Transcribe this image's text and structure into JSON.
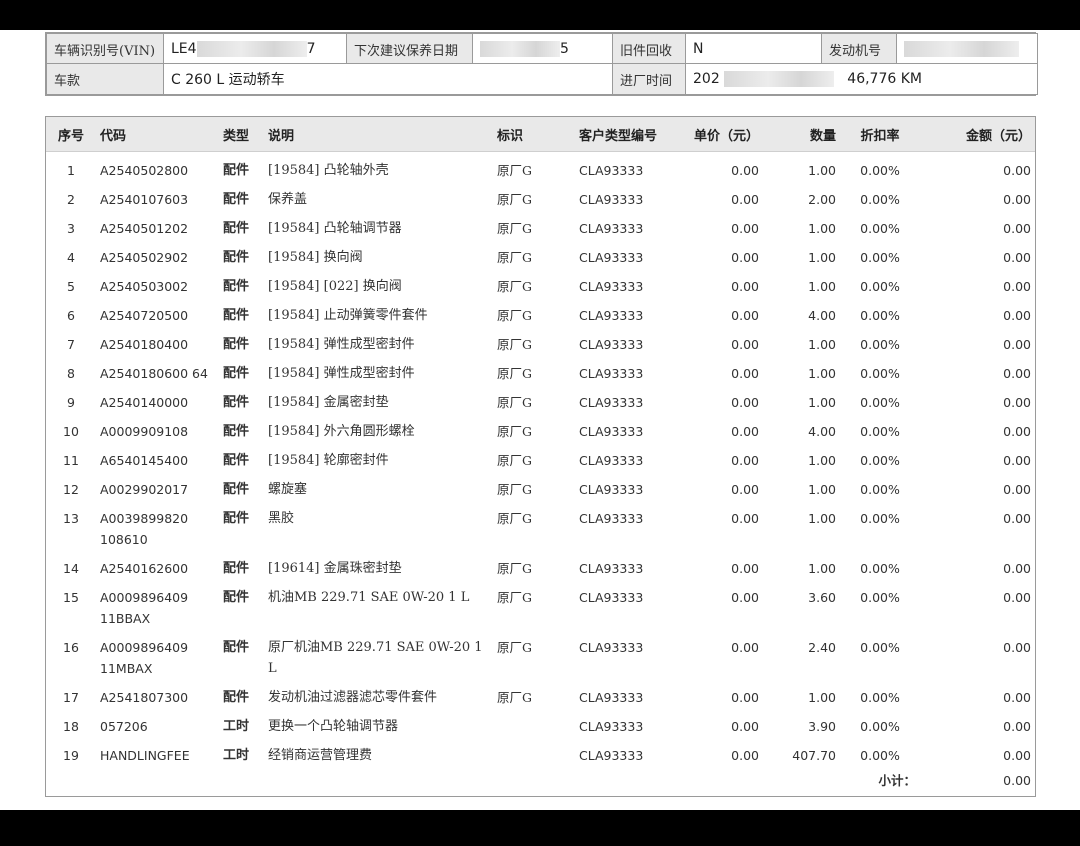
{
  "header": {
    "vin_label": "车辆识别号(VIN)",
    "vin_value": "LE4",
    "vin_tail": "7",
    "next_service_label": "下次建议保养日期",
    "next_service_tail": "5",
    "old_parts_label": "旧件回收",
    "old_parts_value": "N",
    "engine_label": "发动机号",
    "model_label": "车款",
    "model_value": "C 260 L 运动轿车",
    "entry_label": "进厂时间",
    "entry_value": "202",
    "mileage": "46,776 KM"
  },
  "columns": {
    "no": "序号",
    "code": "代码",
    "type": "类型",
    "desc": "说明",
    "flag": "标识",
    "cust": "客户类型编号",
    "price": "单价（元）",
    "qty": "数量",
    "disc": "折扣率",
    "amount": "金额（元）"
  },
  "rows": [
    {
      "no": "1",
      "code": "A2540502800",
      "type": "配件",
      "desc": "[19584] 凸轮轴外壳",
      "flag": "原厂G",
      "cust": "CLA93333",
      "price": "0.00",
      "qty": "1.00",
      "disc": "0.00%",
      "amount": "0.00"
    },
    {
      "no": "2",
      "code": "A2540107603",
      "type": "配件",
      "desc": "保养盖",
      "flag": "原厂G",
      "cust": "CLA93333",
      "price": "0.00",
      "qty": "2.00",
      "disc": "0.00%",
      "amount": "0.00"
    },
    {
      "no": "3",
      "code": "A2540501202",
      "type": "配件",
      "desc": "[19584] 凸轮轴调节器",
      "flag": "原厂G",
      "cust": "CLA93333",
      "price": "0.00",
      "qty": "1.00",
      "disc": "0.00%",
      "amount": "0.00"
    },
    {
      "no": "4",
      "code": "A2540502902",
      "type": "配件",
      "desc": "[19584] 换向阀",
      "flag": "原厂G",
      "cust": "CLA93333",
      "price": "0.00",
      "qty": "1.00",
      "disc": "0.00%",
      "amount": "0.00"
    },
    {
      "no": "5",
      "code": "A2540503002",
      "type": "配件",
      "desc": "[19584] [022] 换向阀",
      "flag": "原厂G",
      "cust": "CLA93333",
      "price": "0.00",
      "qty": "1.00",
      "disc": "0.00%",
      "amount": "0.00"
    },
    {
      "no": "6",
      "code": "A2540720500",
      "type": "配件",
      "desc": "[19584] 止动弹簧零件套件",
      "flag": "原厂G",
      "cust": "CLA93333",
      "price": "0.00",
      "qty": "4.00",
      "disc": "0.00%",
      "amount": "0.00"
    },
    {
      "no": "7",
      "code": "A2540180400",
      "type": "配件",
      "desc": "[19584] 弹性成型密封件",
      "flag": "原厂G",
      "cust": "CLA93333",
      "price": "0.00",
      "qty": "1.00",
      "disc": "0.00%",
      "amount": "0.00"
    },
    {
      "no": "8",
      "code": "A2540180600 64",
      "type": "配件",
      "desc": "[19584] 弹性成型密封件",
      "flag": "原厂G",
      "cust": "CLA93333",
      "price": "0.00",
      "qty": "1.00",
      "disc": "0.00%",
      "amount": "0.00"
    },
    {
      "no": "9",
      "code": "A2540140000",
      "type": "配件",
      "desc": "[19584] 金属密封垫",
      "flag": "原厂G",
      "cust": "CLA93333",
      "price": "0.00",
      "qty": "1.00",
      "disc": "0.00%",
      "amount": "0.00"
    },
    {
      "no": "10",
      "code": "A0009909108",
      "type": "配件",
      "desc": "[19584] 外六角圆形螺栓",
      "flag": "原厂G",
      "cust": "CLA93333",
      "price": "0.00",
      "qty": "4.00",
      "disc": "0.00%",
      "amount": "0.00"
    },
    {
      "no": "11",
      "code": "A6540145400",
      "type": "配件",
      "desc": "[19584] 轮廓密封件",
      "flag": "原厂G",
      "cust": "CLA93333",
      "price": "0.00",
      "qty": "1.00",
      "disc": "0.00%",
      "amount": "0.00"
    },
    {
      "no": "12",
      "code": "A0029902017",
      "type": "配件",
      "desc": "螺旋塞",
      "flag": "原厂G",
      "cust": "CLA93333",
      "price": "0.00",
      "qty": "1.00",
      "disc": "0.00%",
      "amount": "0.00"
    },
    {
      "no": "13",
      "code": "A0039899820 108610",
      "type": "配件",
      "desc": "黑胶",
      "flag": "原厂G",
      "cust": "CLA93333",
      "price": "0.00",
      "qty": "1.00",
      "disc": "0.00%",
      "amount": "0.00"
    },
    {
      "no": "14",
      "code": "A2540162600",
      "type": "配件",
      "desc": "[19614] 金属珠密封垫",
      "flag": "原厂G",
      "cust": "CLA93333",
      "price": "0.00",
      "qty": "1.00",
      "disc": "0.00%",
      "amount": "0.00"
    },
    {
      "no": "15",
      "code": "A0009896409 11BBAX",
      "type": "配件",
      "desc": "机油MB 229.71 SAE 0W-20 1 L",
      "flag": "原厂G",
      "cust": "CLA93333",
      "price": "0.00",
      "qty": "3.60",
      "disc": "0.00%",
      "amount": "0.00"
    },
    {
      "no": "16",
      "code": "A0009896409 11MBAX",
      "type": "配件",
      "desc": "原厂机油MB 229.71 SAE 0W-20 1 L",
      "flag": "原厂G",
      "cust": "CLA93333",
      "price": "0.00",
      "qty": "2.40",
      "disc": "0.00%",
      "amount": "0.00"
    },
    {
      "no": "17",
      "code": "A2541807300",
      "type": "配件",
      "desc": "发动机油过滤器滤芯零件套件",
      "flag": "原厂G",
      "cust": "CLA93333",
      "price": "0.00",
      "qty": "1.00",
      "disc": "0.00%",
      "amount": "0.00"
    },
    {
      "no": "18",
      "code": "057206",
      "type": "工时",
      "desc": "更换一个凸轮轴调节器",
      "flag": "",
      "cust": "CLA93333",
      "price": "0.00",
      "qty": "3.90",
      "disc": "0.00%",
      "amount": "0.00"
    },
    {
      "no": "19",
      "code": "HANDLINGFEE",
      "type": "工时",
      "desc": "经销商运营管理费",
      "flag": "",
      "cust": "CLA93333",
      "price": "0.00",
      "qty": "407.70",
      "disc": "0.00%",
      "amount": "0.00"
    }
  ],
  "subtotal": {
    "label": "小计：",
    "value": "0.00"
  }
}
